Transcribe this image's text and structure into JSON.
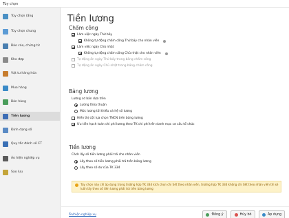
{
  "window": {
    "title": "Tùy chọn"
  },
  "sidebar": {
    "items": [
      {
        "label": "Tùy chọn (ẩng",
        "icon": "options-icon",
        "color": "#4a90c4"
      },
      {
        "label": "Tùy chọn chung",
        "icon": "general-settings-icon",
        "color": "#5b9bd5"
      },
      {
        "label": "Báo cáo, chứng từ",
        "icon": "report-icon",
        "color": "#4a7fb0"
      },
      {
        "label": "Kho đợp",
        "icon": "warehouse-icon",
        "color": "#8a8a8a"
      },
      {
        "label": "Vật tư hàng hóa",
        "icon": "goods-icon",
        "color": "#c77d2e"
      },
      {
        "label": "Mua hàng",
        "icon": "purchase-icon",
        "color": "#3a8ac7"
      },
      {
        "label": "Bán hàng",
        "icon": "sales-icon",
        "color": "#4a9d5b"
      },
      {
        "label": "Tiền lương",
        "icon": "salary-icon",
        "color": "#3d6db5"
      },
      {
        "label": "Định dạng số",
        "icon": "number-format-icon",
        "color": "#5a8ac4"
      },
      {
        "label": "Quy tắc đánh số CT",
        "icon": "numbering-icon",
        "color": "#3a70b5"
      },
      {
        "label": "Áo hiện nghiệp vụ",
        "icon": "business-view-icon",
        "color": "#5a5a5a"
      },
      {
        "label": "Sao lưu",
        "icon": "backup-icon",
        "color": "#c4a53a"
      }
    ]
  },
  "main": {
    "title": "Tiền lương",
    "attendance": {
      "heading": "Chấm công",
      "work_saturday": "Làm việc ngày Thứ bảy",
      "auto_saturday": "Không tự động chấm công Thứ bảy cho nhân viên",
      "work_sunday": "Làm việc ngày Chủ nhật",
      "auto_sunday": "Không tự động chấm công Chủ nhật cho nhân viên",
      "auto_fill_saturday": "Tự động ẩn ngày Thứ bảy trong bảng chấm công",
      "auto_fill_sunday": "Tự động ẩn ngày Chủ nhật trong bảng chấm công"
    },
    "payroll": {
      "heading": "Bảng lương",
      "basis_label": "Lương cơ bản dựa trên",
      "option_agreed": "Lương thỏa thuận",
      "option_insurance": "Mức lương tối thiểu và hệ số lương",
      "show_personal_income_tax": "Hiển thị cột lựa chọn TNCN trên bảng lương",
      "allocate_cost": "Ưu tiên hạch toán chi phí lương theo TK chi phí trên danh mục cơ cấu tổ chức"
    },
    "salary": {
      "heading": "Tiền lương",
      "method_label": "Cách lấy số tiền lương phải trả cho nhân viên",
      "method_payroll": "Lấy theo số tiền lương phải trả trên bảng lương",
      "method_account": "Lấy theo số dư của TK 334",
      "note": "Tùy chọn này chỉ áp dụng trong trường hợp TK 334 kích chọn chi tiết theo nhân viên, trường hợp TK 334 không chi tiết theo nhân viên thì sẽ luôn lấy theo số tiền lương phải trả trên bảng lương"
    }
  },
  "footer": {
    "business_link": "Ẩn/hiện nghiệp vụ",
    "agree_label": "Đồng ý",
    "cancel_label": "Hủy bỏ",
    "apply_label": "Áp dụng"
  },
  "colors": {
    "accent": "#3d6db5",
    "note_bg": "#fdf2c9",
    "note_text": "#8a5a00",
    "agree": "#4a9d5b",
    "cancel": "#d9534f",
    "apply": "#3a8ac7"
  }
}
